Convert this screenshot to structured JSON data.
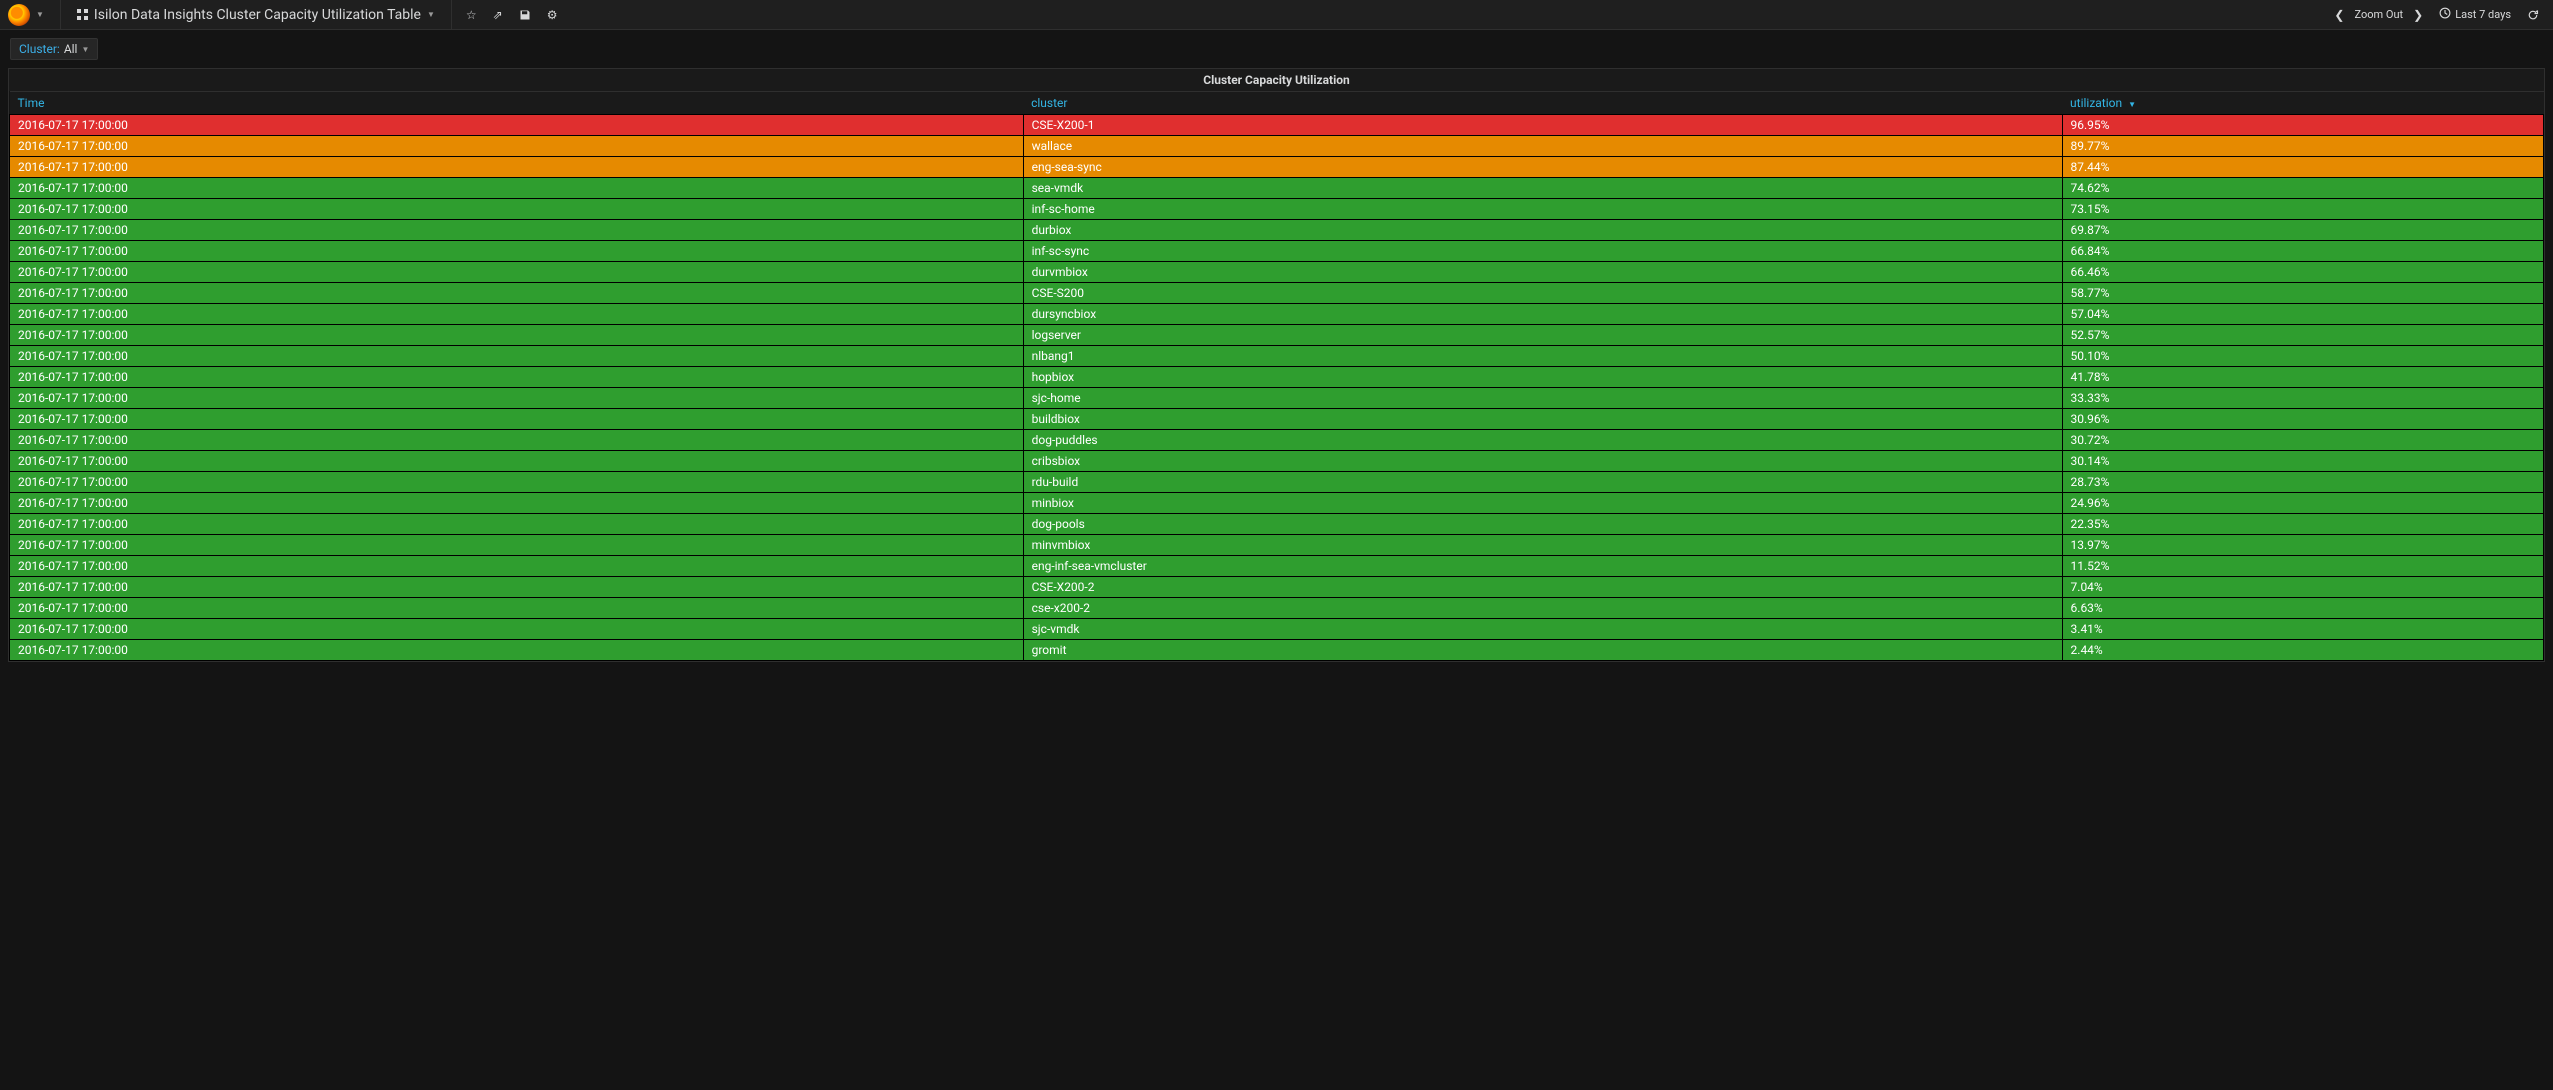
{
  "nav": {
    "dashboard_title": "Isilon Data Insights Cluster Capacity Utilization Table",
    "zoom_out": "Zoom Out",
    "time_range": "Last 7 days"
  },
  "filter": {
    "label": "Cluster:",
    "value": "All"
  },
  "panel": {
    "title": "Cluster Capacity Utilization",
    "columns": {
      "time": "Time",
      "cluster": "cluster",
      "utilization": "utilization"
    }
  },
  "thresholds": {
    "red": 90,
    "orange": 80
  },
  "rows": [
    {
      "time": "2016-07-17 17:00:00",
      "cluster": "CSE-X200-1",
      "utilization": "96.95%",
      "value": 96.95
    },
    {
      "time": "2016-07-17 17:00:00",
      "cluster": "wallace",
      "utilization": "89.77%",
      "value": 89.77
    },
    {
      "time": "2016-07-17 17:00:00",
      "cluster": "eng-sea-sync",
      "utilization": "87.44%",
      "value": 87.44
    },
    {
      "time": "2016-07-17 17:00:00",
      "cluster": "sea-vmdk",
      "utilization": "74.62%",
      "value": 74.62
    },
    {
      "time": "2016-07-17 17:00:00",
      "cluster": "inf-sc-home",
      "utilization": "73.15%",
      "value": 73.15
    },
    {
      "time": "2016-07-17 17:00:00",
      "cluster": "durbiox",
      "utilization": "69.87%",
      "value": 69.87
    },
    {
      "time": "2016-07-17 17:00:00",
      "cluster": "inf-sc-sync",
      "utilization": "66.84%",
      "value": 66.84
    },
    {
      "time": "2016-07-17 17:00:00",
      "cluster": "durvmbiox",
      "utilization": "66.46%",
      "value": 66.46
    },
    {
      "time": "2016-07-17 17:00:00",
      "cluster": "CSE-S200",
      "utilization": "58.77%",
      "value": 58.77
    },
    {
      "time": "2016-07-17 17:00:00",
      "cluster": "dursyncbiox",
      "utilization": "57.04%",
      "value": 57.04
    },
    {
      "time": "2016-07-17 17:00:00",
      "cluster": "logserver",
      "utilization": "52.57%",
      "value": 52.57
    },
    {
      "time": "2016-07-17 17:00:00",
      "cluster": "nlbang1",
      "utilization": "50.10%",
      "value": 50.1
    },
    {
      "time": "2016-07-17 17:00:00",
      "cluster": "hopbiox",
      "utilization": "41.78%",
      "value": 41.78
    },
    {
      "time": "2016-07-17 17:00:00",
      "cluster": "sjc-home",
      "utilization": "33.33%",
      "value": 33.33
    },
    {
      "time": "2016-07-17 17:00:00",
      "cluster": "buildbiox",
      "utilization": "30.96%",
      "value": 30.96
    },
    {
      "time": "2016-07-17 17:00:00",
      "cluster": "dog-puddles",
      "utilization": "30.72%",
      "value": 30.72
    },
    {
      "time": "2016-07-17 17:00:00",
      "cluster": "cribsbiox",
      "utilization": "30.14%",
      "value": 30.14
    },
    {
      "time": "2016-07-17 17:00:00",
      "cluster": "rdu-build",
      "utilization": "28.73%",
      "value": 28.73
    },
    {
      "time": "2016-07-17 17:00:00",
      "cluster": "minbiox",
      "utilization": "24.96%",
      "value": 24.96
    },
    {
      "time": "2016-07-17 17:00:00",
      "cluster": "dog-pools",
      "utilization": "22.35%",
      "value": 22.35
    },
    {
      "time": "2016-07-17 17:00:00",
      "cluster": "minvmbiox",
      "utilization": "13.97%",
      "value": 13.97
    },
    {
      "time": "2016-07-17 17:00:00",
      "cluster": "eng-inf-sea-vmcluster",
      "utilization": "11.52%",
      "value": 11.52
    },
    {
      "time": "2016-07-17 17:00:00",
      "cluster": "CSE-X200-2",
      "utilization": "7.04%",
      "value": 7.04
    },
    {
      "time": "2016-07-17 17:00:00",
      "cluster": "cse-x200-2",
      "utilization": "6.63%",
      "value": 6.63
    },
    {
      "time": "2016-07-17 17:00:00",
      "cluster": "sjc-vmdk",
      "utilization": "3.41%",
      "value": 3.41
    },
    {
      "time": "2016-07-17 17:00:00",
      "cluster": "gromit",
      "utilization": "2.44%",
      "value": 2.44
    }
  ]
}
